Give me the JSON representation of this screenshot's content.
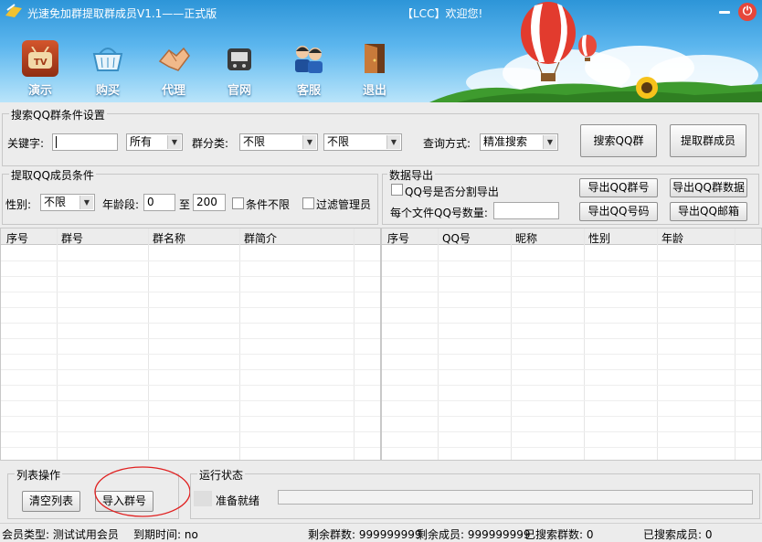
{
  "window": {
    "title": "光速免加群提取群成员V1.1——正式版",
    "welcome": "【LCC】欢迎您!"
  },
  "toolbar": {
    "items": [
      {
        "label": "演示",
        "icon": "tv-icon"
      },
      {
        "label": "购买",
        "icon": "basket-icon"
      },
      {
        "label": "代理",
        "icon": "handshake-icon"
      },
      {
        "label": "官网",
        "icon": "phone-icon"
      },
      {
        "label": "客服",
        "icon": "support-agents-icon"
      },
      {
        "label": "退出",
        "icon": "exit-door-icon"
      }
    ]
  },
  "search_group": {
    "legend": "搜索QQ群条件设置",
    "keyword_label": "关键字:",
    "keyword_value": "",
    "scope_value": "所有",
    "category_label": "群分类:",
    "category1_value": "不限",
    "category2_value": "不限",
    "query_mode_label": "查询方式:",
    "query_mode_value": "精准搜索",
    "search_button": "搜索QQ群",
    "extract_button": "提取群成员"
  },
  "member_group": {
    "legend": "提取QQ成员条件",
    "gender_label": "性别:",
    "gender_value": "不限",
    "age_label": "年龄段:",
    "age_from": "0",
    "age_to_label": "至",
    "age_to": "200",
    "no_condition_label": "条件不限",
    "filter_admin_label": "过滤管理员"
  },
  "export_group": {
    "legend": "数据导出",
    "split_label": "QQ号是否分割导出",
    "per_file_label": "每个文件QQ号数量:",
    "per_file_value": "",
    "btn_export_group_no": "导出QQ群号",
    "btn_export_group_data": "导出QQ群数据",
    "btn_export_qq_no": "导出QQ号码",
    "btn_export_qq_mail": "导出QQ邮箱"
  },
  "group_table": {
    "columns": [
      "序号",
      "群号",
      "群名称",
      "群简介"
    ]
  },
  "member_table": {
    "columns": [
      "序号",
      "QQ号",
      "昵称",
      "性别",
      "年龄"
    ]
  },
  "list_ops": {
    "legend": "列表操作",
    "clear_button": "清空列表",
    "import_button": "导入群号"
  },
  "run_status": {
    "legend": "运行状态",
    "status_text": "准备就绪",
    "progress": 0
  },
  "statusbar": {
    "member_type": "会员类型: 测试试用会员",
    "expire": "到期时间: no",
    "remaining_groups": "剩余群数: 999999999",
    "remaining_members": "剩余成员: 999999999",
    "searched_groups": "已搜索群数: 0",
    "searched_members": "已搜索成员: 0"
  },
  "colors": {
    "header_top": "#2d95d8",
    "highlight_circle": "#e02020"
  }
}
